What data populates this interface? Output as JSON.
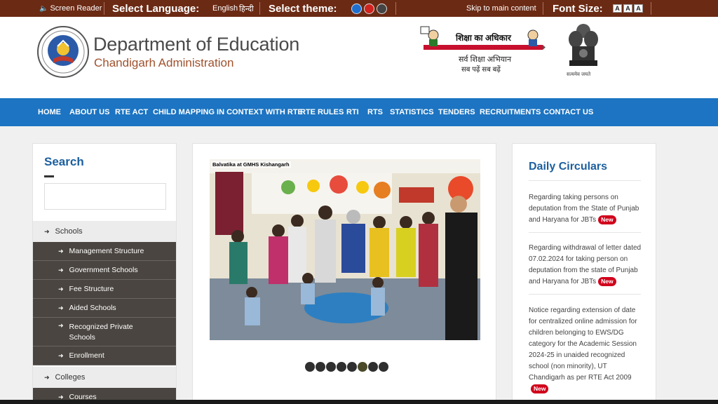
{
  "topbar": {
    "screen_reader": "Screen Reader",
    "select_language": "Select Language:",
    "lang_english": "English",
    "lang_hindi": "हिन्दी",
    "select_theme": "Select theme:",
    "theme_colors": [
      "#1f6fd0",
      "#d0221e",
      "#444444"
    ],
    "skip_link": "Skip to main content",
    "font_size": "Font Size:",
    "font_buttons": [
      "A",
      "A",
      "A"
    ]
  },
  "header": {
    "title": "Department of Education",
    "subtitle": "Chandigarh Administration",
    "rte_text": "शिक्षा का अधिकार",
    "ssa_line1": "सर्व शिक्षा अभियान",
    "ssa_line2": "सब पढ़ें सब बढ़ें",
    "emblem_text": "सत्यमेव जयते"
  },
  "nav": [
    "HOME",
    "ABOUT US",
    "RTE ACT",
    "CHILD MAPPING IN CONTEXT WITH RTE",
    "RTE RULES",
    "RTI",
    "RTS",
    "STATISTICS",
    "TENDERS",
    "RECRUITMENTS",
    "CONTACT US"
  ],
  "sidebar": {
    "search_title": "Search",
    "search_placeholder": "",
    "schools_label": "Schools",
    "schools_items": [
      "Management Structure",
      "Government Schools",
      "Fee Structure",
      "Aided Schools",
      "Recognized Private Schools",
      "Enrollment"
    ],
    "colleges_label": "Colleges",
    "colleges_items": [
      "Courses"
    ]
  },
  "slider": {
    "caption": "Balvatika at GMHS Kishangarh",
    "dot_count": 8,
    "active_dot": 5
  },
  "circulars": {
    "title": "Daily Circulars",
    "new_label": "New",
    "items": [
      "Regarding taking persons on deputation from the State of Punjab and Haryana for JBTs",
      "Regarding withdrawal of letter dated 07.02.2024 for taking person on deputation from the state of Punjab and Haryana for JBTs",
      "Notice regarding extension of date for centralized online admission for children belonging to EWS/DG category for the Academic Session 2024-25 in unaided recognized school (non minority), UT Chandigarh as per RTE Act 2009"
    ]
  }
}
